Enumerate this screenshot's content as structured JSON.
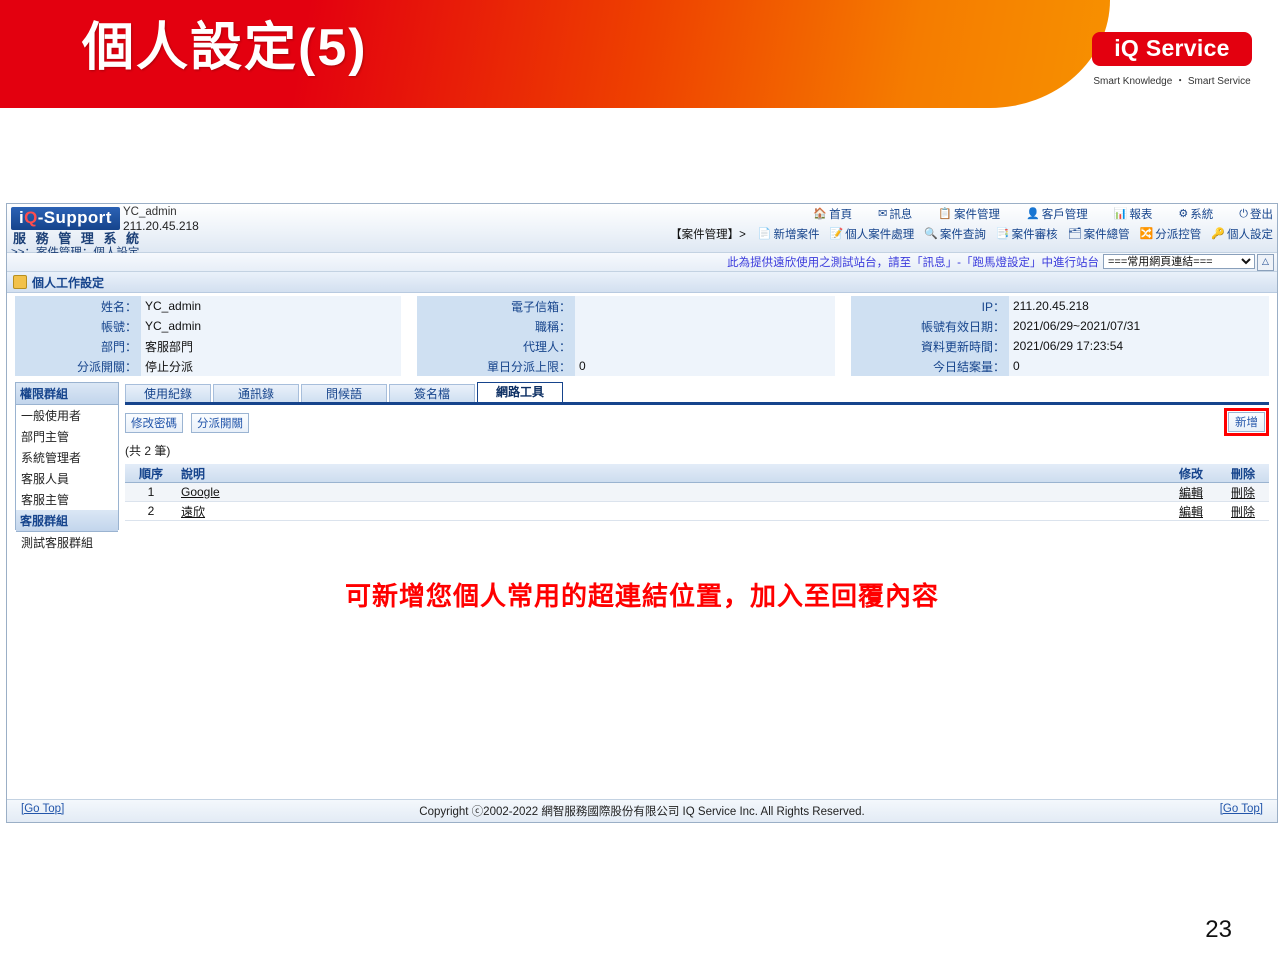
{
  "slide": {
    "title": "個人設定(5)",
    "page_number": "23",
    "logo": {
      "main": "iQ Service",
      "tagline": "Smart Knowledge ・ Smart Service"
    },
    "annotation": "可新增您個人常用的超連結位置，加入至回覆內容"
  },
  "app": {
    "brand": "iQ-Support",
    "brand_sub": "服 務 管 理 系 統",
    "user": {
      "account": "YC_admin",
      "ip": "211.20.45.218"
    },
    "breadcrumb": ">>：案件管理：個人設定",
    "nav_primary": [
      {
        "icon": "home-icon",
        "glyph": "🏠",
        "label": "首頁"
      },
      {
        "icon": "mail-icon",
        "glyph": "✉",
        "label": "訊息"
      },
      {
        "icon": "case-icon",
        "glyph": "📋",
        "label": "案件管理"
      },
      {
        "icon": "customer-icon",
        "glyph": "👤",
        "label": "客戶管理"
      },
      {
        "icon": "report-icon",
        "glyph": "📊",
        "label": "報表"
      },
      {
        "icon": "system-icon",
        "glyph": "⚙",
        "label": "系統"
      },
      {
        "icon": "logout-icon",
        "glyph": "⏻",
        "label": "登出"
      }
    ],
    "nav_context_label": "【案件管理】>",
    "nav_secondary": [
      {
        "icon": "new-case-icon",
        "glyph": "📄",
        "label": "新增案件"
      },
      {
        "icon": "personal-case-icon",
        "glyph": "📝",
        "label": "個人案件處理"
      },
      {
        "icon": "search-case-icon",
        "glyph": "🔍",
        "label": "案件查詢"
      },
      {
        "icon": "review-case-icon",
        "glyph": "📑",
        "label": "案件審核"
      },
      {
        "icon": "manage-case-icon",
        "glyph": "🗂",
        "label": "案件總管"
      },
      {
        "icon": "dispatch-icon",
        "glyph": "🔀",
        "label": "分派控管"
      },
      {
        "icon": "personal-settings-icon",
        "glyph": "🔑",
        "label": "個人設定"
      }
    ],
    "notice": {
      "text": "此為提供遠欣使用之測試站台，請至「訊息」-「跑馬燈設定」中進行站台",
      "select_value": "===常用網頁連結===",
      "button_icon": "expand-icon"
    },
    "section_title": "個人工作設定",
    "info_left": [
      {
        "label": "姓名：",
        "value": "YC_admin"
      },
      {
        "label": "帳號：",
        "value": "YC_admin"
      },
      {
        "label": "部門：",
        "value": "客服部門"
      },
      {
        "label": "分派開關：",
        "value": "停止分派"
      }
    ],
    "info_mid": [
      {
        "label": "電子信箱：",
        "value": ""
      },
      {
        "label": "職稱：",
        "value": ""
      },
      {
        "label": "代理人：",
        "value": ""
      },
      {
        "label": "單日分派上限：",
        "value": "0"
      }
    ],
    "info_right": [
      {
        "label": "IP：",
        "value": "211.20.45.218"
      },
      {
        "label": "帳號有效日期：",
        "value": "2021/06/29~2021/07/31"
      },
      {
        "label": "資料更新時間：",
        "value": "2021/06/29 17:23:54"
      },
      {
        "label": "今日結案量：",
        "value": "0"
      }
    ],
    "sidebar": {
      "group1_title": "權限群組",
      "group1_items": [
        "一般使用者",
        "部門主管",
        "系統管理者",
        "客服人員",
        "客服主管"
      ],
      "group2_title": "客服群組",
      "group2_items": [
        "測試客服群組"
      ]
    },
    "tabs": [
      {
        "label": "使用紀錄",
        "active": false
      },
      {
        "label": "通訊錄",
        "active": false
      },
      {
        "label": "問候語",
        "active": false
      },
      {
        "label": "簽名檔",
        "active": false
      },
      {
        "label": "網路工具",
        "active": true
      }
    ],
    "actions": {
      "change_password": "修改密碼",
      "dispatch_switch": "分派開關",
      "add": "新增"
    },
    "record_count": "(共 2 筆)",
    "table": {
      "headers": {
        "seq": "順序",
        "desc": "說明",
        "edit": "修改",
        "delete": "刪除"
      },
      "rows": [
        {
          "seq": "1",
          "desc": "Google",
          "edit": "編輯",
          "delete": "刪除"
        },
        {
          "seq": "2",
          "desc": "遠欣",
          "edit": "編輯",
          "delete": "刪除"
        }
      ]
    },
    "footer": {
      "copyright": "Copyright ⓒ2002-2022 網智服務國際股份有限公司 IQ Service Inc. All Rights Reserved.",
      "go_top_left": "[Go Top]",
      "go_top_right": "[Go Top]"
    }
  }
}
